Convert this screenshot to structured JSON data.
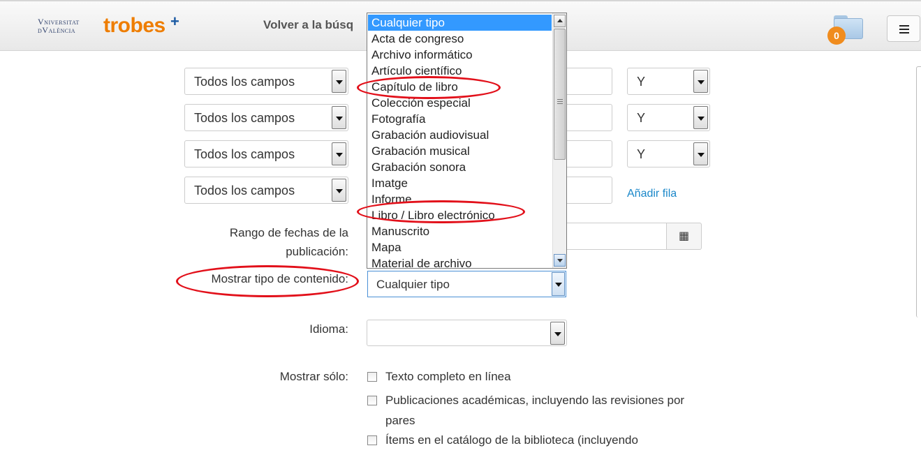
{
  "header": {
    "logo_line1": "Vniversitat",
    "logo_line2": "dValència",
    "logo_brand": "trobes",
    "logo_plus": "+",
    "back_link": "Volver a la búsq",
    "folder_count": "0"
  },
  "search_rows": [
    {
      "field": "Todos los campos",
      "operator": "Y"
    },
    {
      "field": "Todos los campos",
      "operator": "Y"
    },
    {
      "field": "Todos los campos",
      "operator": "Y"
    },
    {
      "field": "Todos los campos"
    }
  ],
  "add_row_label": "Añadir fila",
  "date_range_label": "Rango de fechas de la publicación:",
  "content_type": {
    "label": "Mostrar tipo de contenido:",
    "selected": "Cualquier tipo",
    "options": [
      "Cualquier tipo",
      "Acta de congreso",
      "Archivo informático",
      "Artículo científico",
      "Capítulo de libro",
      "Colección especial",
      "Fotografía",
      "Grabación audiovisual",
      "Grabación musical",
      "Grabación sonora",
      "Imatge",
      "Informe",
      "Libro / Libro electrónico",
      "Manuscrito",
      "Mapa",
      "Material de archivo"
    ]
  },
  "language": {
    "label": "Idioma:",
    "value": ""
  },
  "show_only": {
    "label": "Mostrar sólo:",
    "options": [
      "Texto completo en línea",
      "Publicaciones académicas, incluyendo las revisiones por pares",
      "Ítems en el catálogo de la biblioteca (incluyendo"
    ]
  },
  "annotation_color": "#e2101a",
  "accent_link_color": "#1a87c9",
  "brand_orange": "#ee7d00",
  "brand_blue": "#1b5aa3"
}
